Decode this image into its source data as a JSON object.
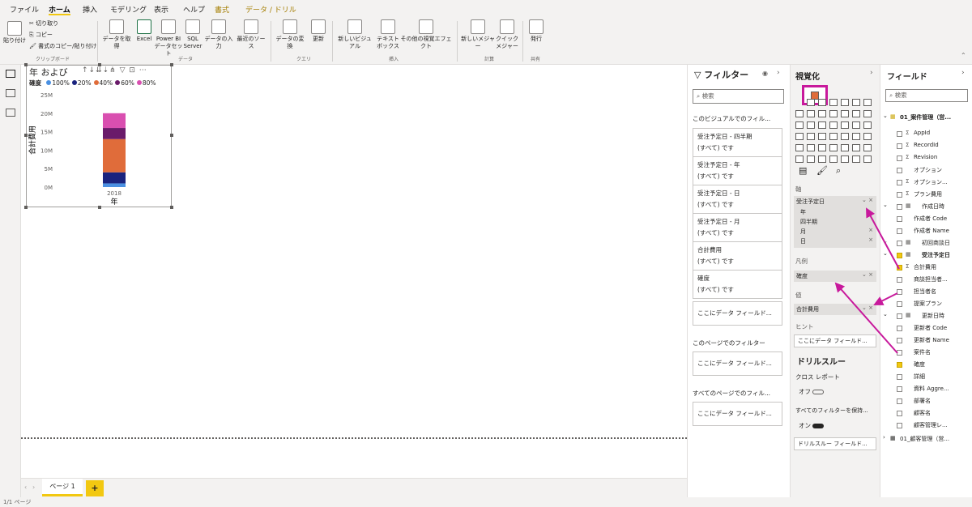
{
  "ribbon": {
    "tabs": [
      "ファイル",
      "ホーム",
      "挿入",
      "モデリング",
      "表示",
      "ヘルプ",
      "書式",
      "データ / ドリル"
    ],
    "clipboard": {
      "paste": "貼り付け",
      "cut": "切り取り",
      "copy": "コピー",
      "format_painter": "書式のコピー/貼り付け",
      "group": "クリップボード"
    },
    "data": {
      "get_data": "データを取得",
      "excel": "Excel",
      "pbi_dataset": "Power BI データセット",
      "sql": "SQL Server",
      "enter_data": "データの入力",
      "recent_sources": "最近のソース",
      "group": "データ"
    },
    "queries": {
      "transform": "データの変換",
      "refresh": "更新",
      "group": "クエリ"
    },
    "insert": {
      "new_visual": "新しいビジュアル",
      "textbox": "テキスト ボックス",
      "more_visuals": "その他の視覚エフェクト",
      "group": "挿入"
    },
    "calculations": {
      "new_measure": "新しいメジャー",
      "quick_measure": "クイック メジャー",
      "group": "計算"
    },
    "share": {
      "publish": "発行",
      "group": "共有"
    }
  },
  "visual": {
    "title": "年 および",
    "legend_title": "確度",
    "legend": [
      {
        "label": "100%",
        "color": "#4a90e2"
      },
      {
        "label": "20%",
        "color": "#1a237e"
      },
      {
        "label": "40%",
        "color": "#e06c3a"
      },
      {
        "label": "60%",
        "color": "#6a1b6a"
      },
      {
        "label": "80%",
        "color": "#d94fb0"
      }
    ],
    "y_axis_label": "合計費用",
    "x_axis_label": "年"
  },
  "chart_data": {
    "type": "bar",
    "stacked": true,
    "categories": [
      "2018"
    ],
    "ylim": [
      0,
      25000000
    ],
    "yticks": [
      "0M",
      "5M",
      "10M",
      "15M",
      "20M",
      "25M"
    ],
    "series": [
      {
        "name": "100%",
        "values": [
          1000000
        ],
        "color": "#4a90e2"
      },
      {
        "name": "20%",
        "values": [
          3000000
        ],
        "color": "#1a237e"
      },
      {
        "name": "40%",
        "values": [
          9000000
        ],
        "color": "#e06c3a"
      },
      {
        "name": "60%",
        "values": [
          3000000
        ],
        "color": "#6a1b6a"
      },
      {
        "name": "80%",
        "values": [
          4000000
        ],
        "color": "#d94fb0"
      }
    ],
    "xlabel": "年",
    "ylabel": "合計費用"
  },
  "page": {
    "tab": "ページ 1",
    "add": "+",
    "status": "1/1 ページ"
  },
  "filters": {
    "title": "フィルター",
    "search_placeholder": "検索",
    "visual_section": "このビジュアルでのフィル...",
    "cards": [
      {
        "name": "受注予定日 - 四半期",
        "value": "(すべて) です"
      },
      {
        "name": "受注予定日 - 年",
        "value": "(すべて) です"
      },
      {
        "name": "受注予定日 - 日",
        "value": "(すべて) です"
      },
      {
        "name": "受注予定日 - 月",
        "value": "(すべて) です"
      },
      {
        "name": "合計費用",
        "value": "(すべて) です"
      },
      {
        "name": "確度",
        "value": "(すべて) です"
      }
    ],
    "add_field": "ここにデータ フィールド...",
    "page_section": "このページでのフィルター",
    "all_pages_section": "すべてのページでのフィル..."
  },
  "viz": {
    "title": "視覚化",
    "axis_label": "軸",
    "axis_field": "受注予定日",
    "axis_items": [
      "年",
      "四半期",
      "月",
      "日"
    ],
    "legend_label": "凡例",
    "legend_field": "確度",
    "value_label": "値",
    "value_field": "合計費用",
    "tooltip_label": "ヒント",
    "tooltip_add": "ここにデータ フィールド...",
    "drill_title": "ドリルスルー",
    "cross_report": "クロス レポート",
    "off": "オフ",
    "keep_filters": "すべてのフィルターを保持...",
    "on": "オン",
    "drill_add": "ドリルスルー フィールド..."
  },
  "fields": {
    "title": "フィールド",
    "search_placeholder": "検索",
    "table1": "01_案件管理（営...",
    "items": [
      {
        "label": "AppId",
        "sigma": true,
        "checked": false,
        "indent": 1
      },
      {
        "label": "RecordId",
        "sigma": true,
        "checked": false,
        "indent": 1
      },
      {
        "label": "Revision",
        "sigma": true,
        "checked": false,
        "indent": 1
      },
      {
        "label": "オプション",
        "sigma": false,
        "checked": false,
        "indent": 1
      },
      {
        "label": "オプション...",
        "sigma": true,
        "checked": false,
        "indent": 1
      },
      {
        "label": "プラン費用",
        "sigma": true,
        "checked": false,
        "indent": 1
      },
      {
        "label": "作成日時",
        "sigma": false,
        "checked": false,
        "indent": 0,
        "group": true
      },
      {
        "label": "作成者 Code",
        "sigma": false,
        "checked": false,
        "indent": 1
      },
      {
        "label": "作成者 Name",
        "sigma": false,
        "checked": false,
        "indent": 1
      },
      {
        "label": "初回商談日",
        "sigma": false,
        "checked": false,
        "indent": 0,
        "group": true
      },
      {
        "label": "受注予定日",
        "sigma": false,
        "checked": true,
        "indent": 0,
        "group": true,
        "bold": true
      },
      {
        "label": "合計費用",
        "sigma": true,
        "checked": true,
        "indent": 1
      },
      {
        "label": "商談担当者...",
        "sigma": false,
        "checked": false,
        "indent": 1
      },
      {
        "label": "担当者名",
        "sigma": false,
        "checked": false,
        "indent": 1
      },
      {
        "label": "提案プラン",
        "sigma": false,
        "checked": false,
        "indent": 1
      },
      {
        "label": "更新日時",
        "sigma": false,
        "checked": false,
        "indent": 0,
        "group": true
      },
      {
        "label": "更新者 Code",
        "sigma": false,
        "checked": false,
        "indent": 1
      },
      {
        "label": "更新者 Name",
        "sigma": false,
        "checked": false,
        "indent": 1
      },
      {
        "label": "案件名",
        "sigma": false,
        "checked": false,
        "indent": 1
      },
      {
        "label": "確度",
        "sigma": false,
        "checked": true,
        "indent": 1
      },
      {
        "label": "詳細",
        "sigma": false,
        "checked": false,
        "indent": 1
      },
      {
        "label": "資料 Aggre...",
        "sigma": false,
        "checked": false,
        "indent": 1
      },
      {
        "label": "部署名",
        "sigma": false,
        "checked": false,
        "indent": 1
      },
      {
        "label": "顧客名",
        "sigma": false,
        "checked": false,
        "indent": 1
      },
      {
        "label": "顧客管理レ...",
        "sigma": false,
        "checked": false,
        "indent": 1
      }
    ],
    "table2": "01_顧客管理（営..."
  },
  "colors": {
    "accent": "#f2c811",
    "highlight": "#c8199c"
  }
}
